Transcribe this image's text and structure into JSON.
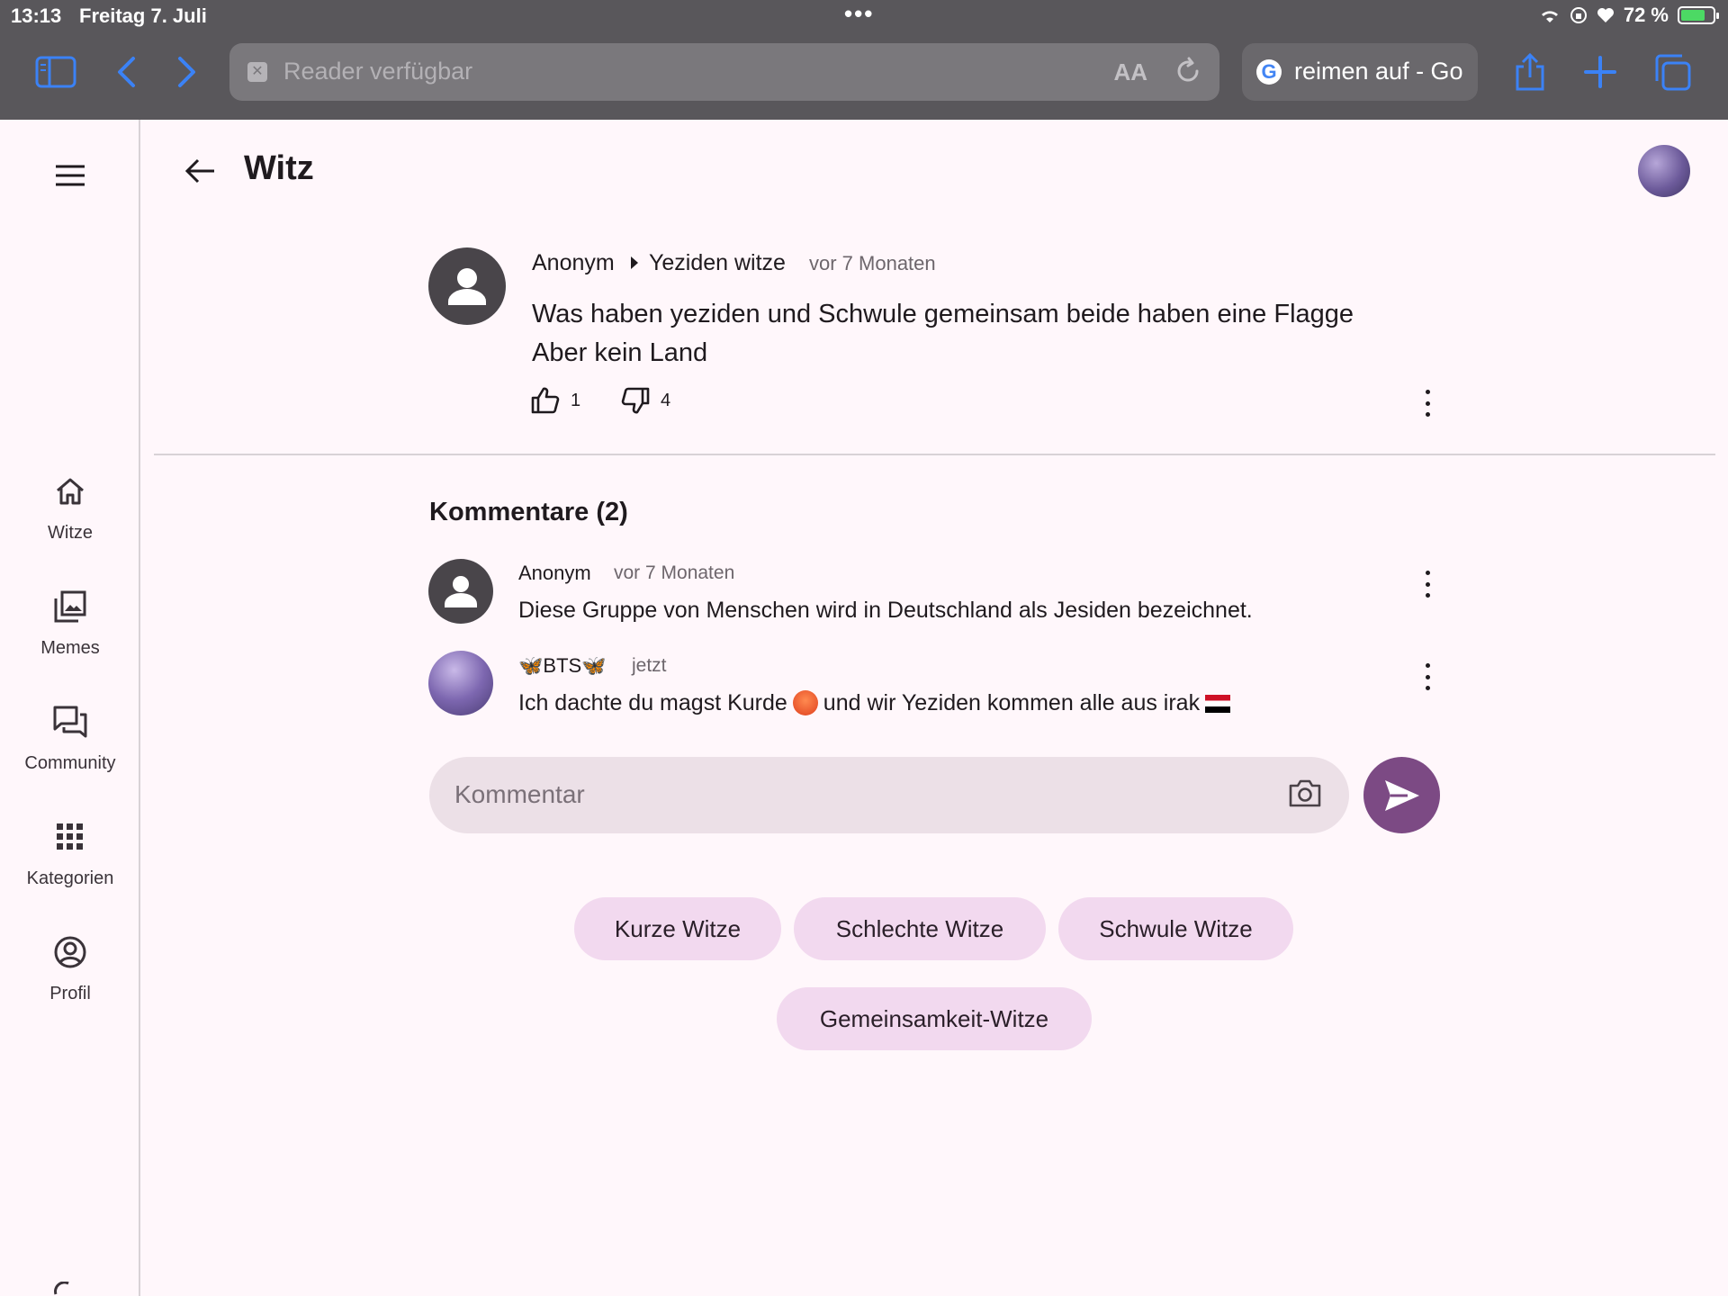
{
  "status_bar": {
    "time": "13:13",
    "date": "Freitag 7. Juli",
    "battery": "72 %"
  },
  "browser": {
    "url_text": "Reader verfügbar",
    "text_size": "AA",
    "other_tab": "reimen auf - Go"
  },
  "sidebar": {
    "items": [
      {
        "label": "Witze",
        "icon": "home-icon"
      },
      {
        "label": "Memes",
        "icon": "image-gallery-icon"
      },
      {
        "label": "Community",
        "icon": "chat-icon"
      },
      {
        "label": "Kategorien",
        "icon": "grid-icon"
      },
      {
        "label": "Profil",
        "icon": "account-circle-icon"
      }
    ]
  },
  "header": {
    "title": "Witz"
  },
  "post": {
    "author": "Anonym",
    "category": "Yeziden witze",
    "time": "vor 7 Monaten",
    "text": "Was haben yeziden und Schwule gemeinsam beide haben eine Flagge Aber kein Land",
    "likes": "1",
    "dislikes": "4"
  },
  "comments": {
    "title": "Kommentare (2)",
    "items": [
      {
        "author": "Anonym",
        "time": "vor 7 Monaten",
        "text": "Diese Gruppe von Menschen wird in Deutschland als Jesiden bezeichnet."
      },
      {
        "author": "🦋BTS🦋",
        "time": "jetzt",
        "text_part1": "Ich dachte du magst Kurde",
        "text_part2": "und wir Yeziden kommen alle aus irak"
      }
    ]
  },
  "comment_input": {
    "placeholder": "Kommentar",
    "value": ""
  },
  "tags": [
    "Kurze Witze",
    "Schlechte Witze",
    "Schwule Witze",
    "Gemeinsamkeit-Witze"
  ],
  "colors": {
    "accent": "#7c4a84",
    "chip": "#f2d9ef",
    "background": "#fff7fb"
  }
}
